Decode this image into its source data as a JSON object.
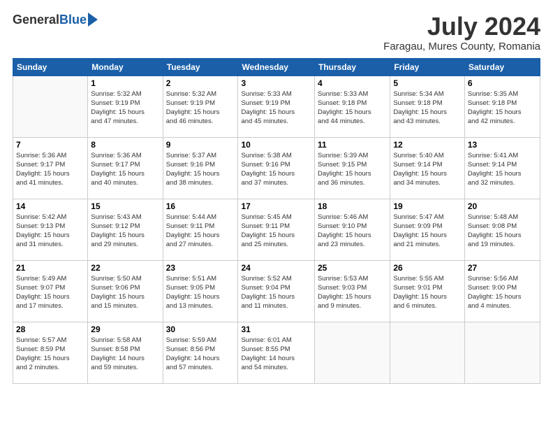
{
  "logo": {
    "general": "General",
    "blue": "Blue"
  },
  "title": "July 2024",
  "location": "Faragau, Mures County, Romania",
  "days_header": [
    "Sunday",
    "Monday",
    "Tuesday",
    "Wednesday",
    "Thursday",
    "Friday",
    "Saturday"
  ],
  "weeks": [
    [
      {
        "num": "",
        "info": ""
      },
      {
        "num": "1",
        "info": "Sunrise: 5:32 AM\nSunset: 9:19 PM\nDaylight: 15 hours\nand 47 minutes."
      },
      {
        "num": "2",
        "info": "Sunrise: 5:32 AM\nSunset: 9:19 PM\nDaylight: 15 hours\nand 46 minutes."
      },
      {
        "num": "3",
        "info": "Sunrise: 5:33 AM\nSunset: 9:19 PM\nDaylight: 15 hours\nand 45 minutes."
      },
      {
        "num": "4",
        "info": "Sunrise: 5:33 AM\nSunset: 9:18 PM\nDaylight: 15 hours\nand 44 minutes."
      },
      {
        "num": "5",
        "info": "Sunrise: 5:34 AM\nSunset: 9:18 PM\nDaylight: 15 hours\nand 43 minutes."
      },
      {
        "num": "6",
        "info": "Sunrise: 5:35 AM\nSunset: 9:18 PM\nDaylight: 15 hours\nand 42 minutes."
      }
    ],
    [
      {
        "num": "7",
        "info": "Sunrise: 5:36 AM\nSunset: 9:17 PM\nDaylight: 15 hours\nand 41 minutes."
      },
      {
        "num": "8",
        "info": "Sunrise: 5:36 AM\nSunset: 9:17 PM\nDaylight: 15 hours\nand 40 minutes."
      },
      {
        "num": "9",
        "info": "Sunrise: 5:37 AM\nSunset: 9:16 PM\nDaylight: 15 hours\nand 38 minutes."
      },
      {
        "num": "10",
        "info": "Sunrise: 5:38 AM\nSunset: 9:16 PM\nDaylight: 15 hours\nand 37 minutes."
      },
      {
        "num": "11",
        "info": "Sunrise: 5:39 AM\nSunset: 9:15 PM\nDaylight: 15 hours\nand 36 minutes."
      },
      {
        "num": "12",
        "info": "Sunrise: 5:40 AM\nSunset: 9:14 PM\nDaylight: 15 hours\nand 34 minutes."
      },
      {
        "num": "13",
        "info": "Sunrise: 5:41 AM\nSunset: 9:14 PM\nDaylight: 15 hours\nand 32 minutes."
      }
    ],
    [
      {
        "num": "14",
        "info": "Sunrise: 5:42 AM\nSunset: 9:13 PM\nDaylight: 15 hours\nand 31 minutes."
      },
      {
        "num": "15",
        "info": "Sunrise: 5:43 AM\nSunset: 9:12 PM\nDaylight: 15 hours\nand 29 minutes."
      },
      {
        "num": "16",
        "info": "Sunrise: 5:44 AM\nSunset: 9:11 PM\nDaylight: 15 hours\nand 27 minutes."
      },
      {
        "num": "17",
        "info": "Sunrise: 5:45 AM\nSunset: 9:11 PM\nDaylight: 15 hours\nand 25 minutes."
      },
      {
        "num": "18",
        "info": "Sunrise: 5:46 AM\nSunset: 9:10 PM\nDaylight: 15 hours\nand 23 minutes."
      },
      {
        "num": "19",
        "info": "Sunrise: 5:47 AM\nSunset: 9:09 PM\nDaylight: 15 hours\nand 21 minutes."
      },
      {
        "num": "20",
        "info": "Sunrise: 5:48 AM\nSunset: 9:08 PM\nDaylight: 15 hours\nand 19 minutes."
      }
    ],
    [
      {
        "num": "21",
        "info": "Sunrise: 5:49 AM\nSunset: 9:07 PM\nDaylight: 15 hours\nand 17 minutes."
      },
      {
        "num": "22",
        "info": "Sunrise: 5:50 AM\nSunset: 9:06 PM\nDaylight: 15 hours\nand 15 minutes."
      },
      {
        "num": "23",
        "info": "Sunrise: 5:51 AM\nSunset: 9:05 PM\nDaylight: 15 hours\nand 13 minutes."
      },
      {
        "num": "24",
        "info": "Sunrise: 5:52 AM\nSunset: 9:04 PM\nDaylight: 15 hours\nand 11 minutes."
      },
      {
        "num": "25",
        "info": "Sunrise: 5:53 AM\nSunset: 9:03 PM\nDaylight: 15 hours\nand 9 minutes."
      },
      {
        "num": "26",
        "info": "Sunrise: 5:55 AM\nSunset: 9:01 PM\nDaylight: 15 hours\nand 6 minutes."
      },
      {
        "num": "27",
        "info": "Sunrise: 5:56 AM\nSunset: 9:00 PM\nDaylight: 15 hours\nand 4 minutes."
      }
    ],
    [
      {
        "num": "28",
        "info": "Sunrise: 5:57 AM\nSunset: 8:59 PM\nDaylight: 15 hours\nand 2 minutes."
      },
      {
        "num": "29",
        "info": "Sunrise: 5:58 AM\nSunset: 8:58 PM\nDaylight: 14 hours\nand 59 minutes."
      },
      {
        "num": "30",
        "info": "Sunrise: 5:59 AM\nSunset: 8:56 PM\nDaylight: 14 hours\nand 57 minutes."
      },
      {
        "num": "31",
        "info": "Sunrise: 6:01 AM\nSunset: 8:55 PM\nDaylight: 14 hours\nand 54 minutes."
      },
      {
        "num": "",
        "info": ""
      },
      {
        "num": "",
        "info": ""
      },
      {
        "num": "",
        "info": ""
      }
    ]
  ]
}
